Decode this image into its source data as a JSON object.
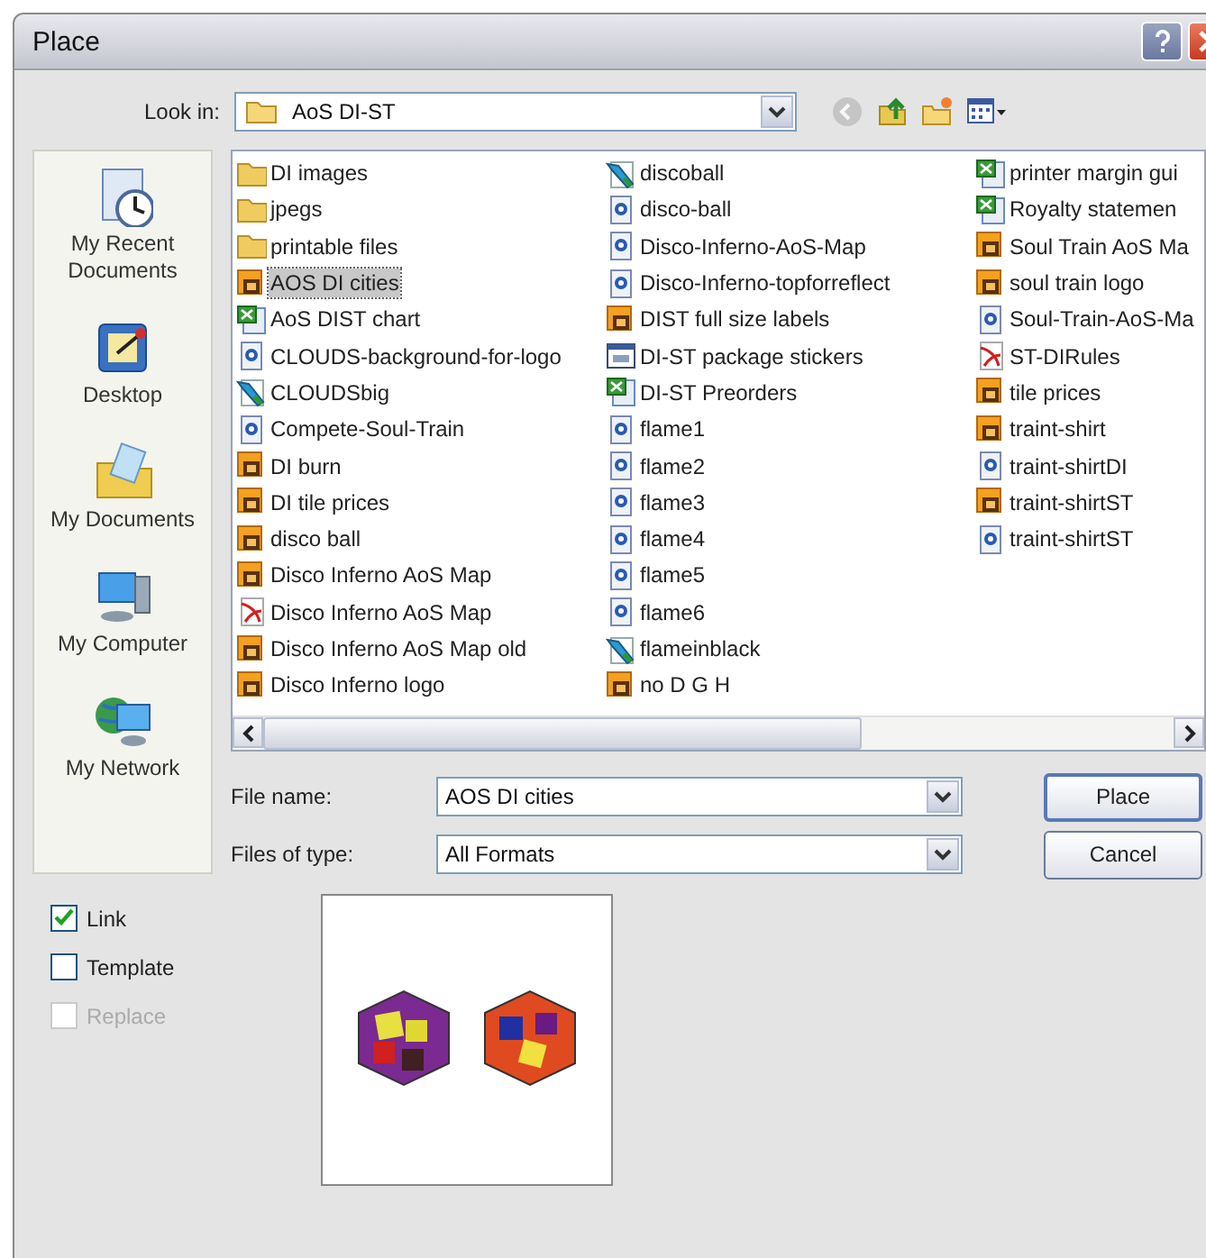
{
  "window": {
    "title": "Place"
  },
  "look_in": {
    "label": "Look in:",
    "value": "AoS DI-ST"
  },
  "toolbar": [
    {
      "kind": "back",
      "disabled": true
    },
    {
      "kind": "up",
      "disabled": false
    },
    {
      "kind": "newfolder",
      "disabled": false
    },
    {
      "kind": "views",
      "disabled": false
    }
  ],
  "sidebar": {
    "items": [
      {
        "kind": "recent",
        "label": "My Recent Documents"
      },
      {
        "kind": "desktop",
        "label": "Desktop"
      },
      {
        "kind": "documents",
        "label": "My Documents"
      },
      {
        "kind": "computer",
        "label": "My Computer"
      },
      {
        "kind": "network",
        "label": "My Network"
      }
    ]
  },
  "files": [
    {
      "kind": "folder",
      "name": "DI images",
      "selected": false
    },
    {
      "kind": "folder",
      "name": "jpegs",
      "selected": false
    },
    {
      "kind": "folder",
      "name": "printable files",
      "selected": false
    },
    {
      "kind": "ai",
      "name": "AOS DI cities",
      "selected": true
    },
    {
      "kind": "excel",
      "name": "AoS DIST chart",
      "selected": false
    },
    {
      "kind": "psd",
      "name": "CLOUDS-background-for-logo",
      "selected": false
    },
    {
      "kind": "corel",
      "name": "CLOUDSbig",
      "selected": false
    },
    {
      "kind": "psd",
      "name": "Compete-Soul-Train",
      "selected": false
    },
    {
      "kind": "ai",
      "name": "DI burn",
      "selected": false
    },
    {
      "kind": "ai",
      "name": "DI tile prices",
      "selected": false
    },
    {
      "kind": "ai",
      "name": "disco ball",
      "selected": false
    },
    {
      "kind": "ai",
      "name": "Disco Inferno AoS Map",
      "selected": false
    },
    {
      "kind": "pdf",
      "name": "Disco Inferno AoS Map",
      "selected": false
    },
    {
      "kind": "ai",
      "name": "Disco Inferno AoS Map old",
      "selected": false
    },
    {
      "kind": "ai",
      "name": "Disco Inferno logo",
      "selected": false
    },
    {
      "kind": "corel",
      "name": "discoball",
      "selected": false
    },
    {
      "kind": "psd",
      "name": "disco-ball",
      "selected": false
    },
    {
      "kind": "psd",
      "name": "Disco-Inferno-AoS-Map",
      "selected": false
    },
    {
      "kind": "psd",
      "name": "Disco-Inferno-topforreflect",
      "selected": false
    },
    {
      "kind": "ai",
      "name": "DIST full size labels",
      "selected": false
    },
    {
      "kind": "web",
      "name": "DI-ST package stickers",
      "selected": false
    },
    {
      "kind": "excel",
      "name": "DI-ST Preorders",
      "selected": false
    },
    {
      "kind": "psd",
      "name": "flame1",
      "selected": false
    },
    {
      "kind": "psd",
      "name": "flame2",
      "selected": false
    },
    {
      "kind": "psd",
      "name": "flame3",
      "selected": false
    },
    {
      "kind": "psd",
      "name": "flame4",
      "selected": false
    },
    {
      "kind": "psd",
      "name": "flame5",
      "selected": false
    },
    {
      "kind": "psd",
      "name": "flame6",
      "selected": false
    },
    {
      "kind": "corel",
      "name": "flameinblack",
      "selected": false
    },
    {
      "kind": "ai",
      "name": "no D G H",
      "selected": false
    },
    {
      "kind": "excel",
      "name": "printer margin gui",
      "selected": false
    },
    {
      "kind": "excel",
      "name": "Royalty statemen",
      "selected": false
    },
    {
      "kind": "ai",
      "name": "Soul Train AoS Ma",
      "selected": false
    },
    {
      "kind": "ai",
      "name": "soul train logo",
      "selected": false
    },
    {
      "kind": "psd",
      "name": "Soul-Train-AoS-Ma",
      "selected": false
    },
    {
      "kind": "pdf",
      "name": "ST-DIRules",
      "selected": false
    },
    {
      "kind": "ai",
      "name": "tile prices",
      "selected": false
    },
    {
      "kind": "ai",
      "name": "traint-shirt",
      "selected": false
    },
    {
      "kind": "psd",
      "name": "traint-shirtDI",
      "selected": false
    },
    {
      "kind": "ai",
      "name": "traint-shirtST",
      "selected": false
    },
    {
      "kind": "psd",
      "name": "traint-shirtST",
      "selected": false
    }
  ],
  "file_name": {
    "label": "File name:",
    "value": "AOS DI cities"
  },
  "files_of_type": {
    "label": "Files of type:",
    "value": "All Formats"
  },
  "buttons": [
    {
      "label": "Place",
      "default": true
    },
    {
      "label": "Cancel",
      "default": false
    }
  ],
  "options": [
    {
      "label": "Link",
      "checked": true,
      "disabled": false
    },
    {
      "label": "Template",
      "checked": false,
      "disabled": false
    },
    {
      "label": "Replace",
      "checked": false,
      "disabled": true
    }
  ]
}
